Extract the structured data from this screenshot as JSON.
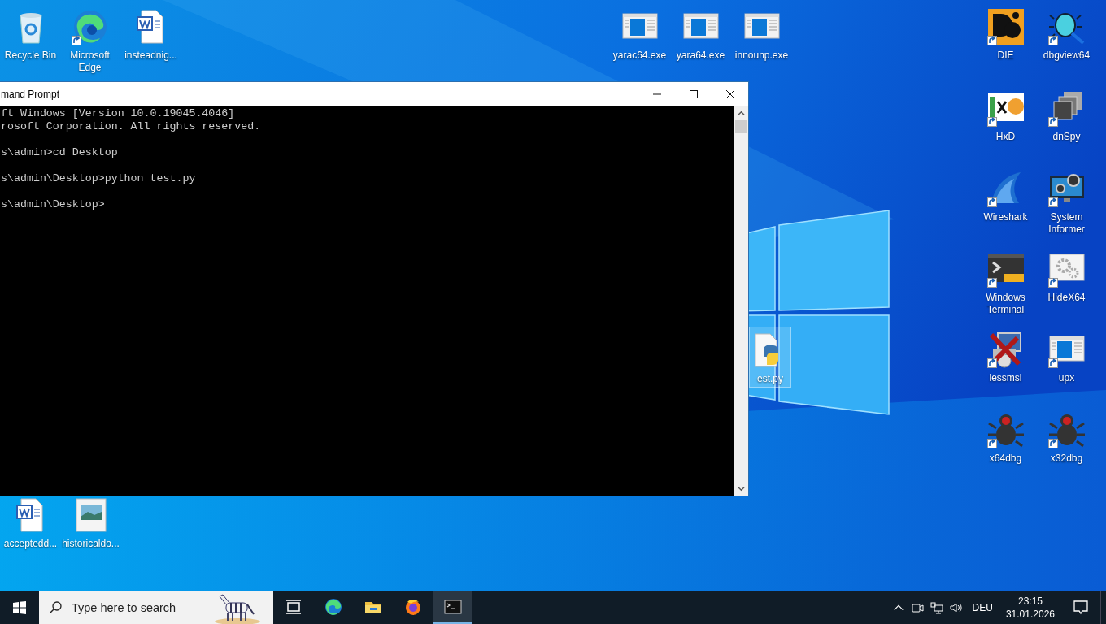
{
  "desktop_icons": [
    {
      "label": "Recycle Bin",
      "shortcut": false,
      "selected": false
    },
    {
      "label": "Microsoft Edge",
      "shortcut": true,
      "selected": false
    },
    {
      "label": "insteadnig...",
      "shortcut": false,
      "selected": false
    },
    {
      "label": "yarac64.exe",
      "shortcut": false,
      "selected": false
    },
    {
      "label": "yara64.exe",
      "shortcut": false,
      "selected": false
    },
    {
      "label": "innounp.exe",
      "shortcut": false,
      "selected": false
    },
    {
      "label": "DIE",
      "shortcut": true,
      "selected": false
    },
    {
      "label": "dbgview64",
      "shortcut": true,
      "selected": false
    },
    {
      "label": "HxD",
      "shortcut": true,
      "selected": false
    },
    {
      "label": "dnSpy",
      "shortcut": true,
      "selected": false
    },
    {
      "label": "Wireshark",
      "shortcut": true,
      "selected": false
    },
    {
      "label": "System Informer",
      "shortcut": true,
      "selected": false
    },
    {
      "label": "est.py",
      "shortcut": false,
      "selected": true
    },
    {
      "label": "Windows Terminal",
      "shortcut": true,
      "selected": false
    },
    {
      "label": "HideX64",
      "shortcut": true,
      "selected": false
    },
    {
      "label": "lessmsi",
      "shortcut": true,
      "selected": false
    },
    {
      "label": "upx",
      "shortcut": true,
      "selected": false
    },
    {
      "label": "x64dbg",
      "shortcut": true,
      "selected": false
    },
    {
      "label": "x32dbg",
      "shortcut": true,
      "selected": false
    },
    {
      "label": "acceptedd...",
      "shortcut": false,
      "selected": false
    },
    {
      "label": "historicaldo...",
      "shortcut": false,
      "selected": false
    }
  ],
  "cmd_window": {
    "title": "mand Prompt",
    "blocks": [
      [
        "ft Windows [Version 10.0.19045.4046]",
        "rosoft Corporation. All rights reserved."
      ],
      [
        "s\\admin>cd Desktop"
      ],
      [
        "s\\admin\\Desktop>python test.py"
      ],
      [
        "s\\admin\\Desktop>"
      ]
    ]
  },
  "taskbar": {
    "search": {
      "placeholder": "Type here to search"
    },
    "apps": [
      {
        "selected": false
      },
      {
        "selected": false
      },
      {
        "selected": false
      },
      {
        "selected": false
      },
      {
        "selected": true
      }
    ],
    "tray": {
      "language": "DEU",
      "time": "23:15",
      "date": "31.01.2026"
    }
  }
}
